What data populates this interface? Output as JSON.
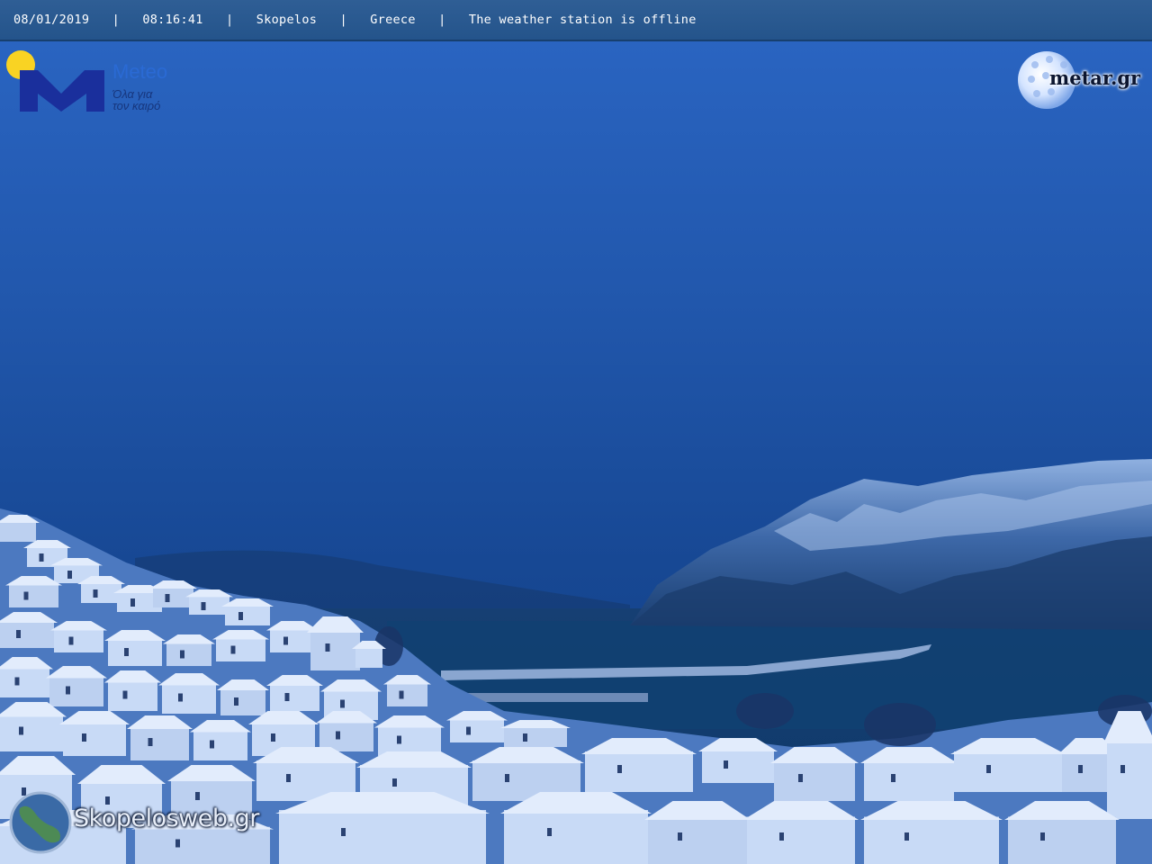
{
  "overlay": {
    "date": "08/01/2019",
    "time": "08:16:41",
    "location": "Skopelos",
    "country": "Greece",
    "status": "The weather station is offline",
    "separator": "|"
  },
  "logos": {
    "meteo_name": "Meteo",
    "meteo_tagline_line1": "Όλα για",
    "meteo_tagline_line2": "τον καιρό",
    "metar": "metar.gr",
    "skopelosweb": "Skopelosweb.gr"
  },
  "colors": {
    "sky_top": "#2b66c4",
    "sky_mid": "#1c4c9c",
    "sea": "#0f3d6e",
    "snow_roof": "#dfe9fb",
    "topbar": "#2b5b93",
    "meteo_blue": "#1a2f9c",
    "sun_yellow": "#f9d323"
  }
}
